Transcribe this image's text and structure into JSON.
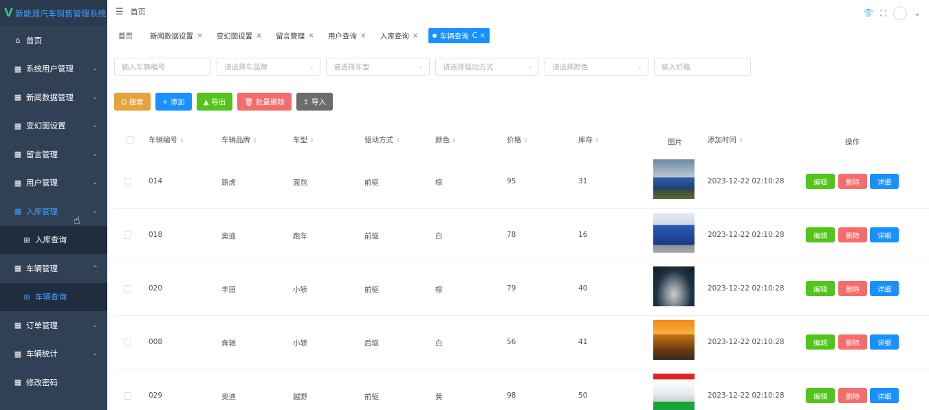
{
  "app": {
    "logo_letter": "V",
    "title": "新能源汽车销售管理系统"
  },
  "topbar": {
    "breadcrumb": "首页"
  },
  "sidebar": {
    "items": [
      {
        "label": "首页",
        "icon": "home-icon",
        "glyph": "⌂",
        "arrow": ""
      },
      {
        "label": "系统用户管理",
        "icon": "grid-icon",
        "glyph": "▦",
        "arrow": "⌄"
      },
      {
        "label": "新闻数据管理",
        "icon": "grid-icon",
        "glyph": "▦",
        "arrow": "⌄"
      },
      {
        "label": "变幻图设置",
        "icon": "grid-icon",
        "glyph": "▦",
        "arrow": "⌄"
      },
      {
        "label": "留言管理",
        "icon": "grid-icon",
        "glyph": "▦",
        "arrow": "⌄"
      },
      {
        "label": "用户管理",
        "icon": "grid-icon",
        "glyph": "▦",
        "arrow": "⌄"
      },
      {
        "label": "入库管理",
        "icon": "grid-icon",
        "glyph": "▦",
        "arrow": "⌄"
      },
      {
        "label": "入库查询",
        "icon": "apps-icon",
        "glyph": "⊞",
        "arrow": ""
      },
      {
        "label": "车辆管理",
        "icon": "grid-icon",
        "glyph": "▦",
        "arrow": "^"
      },
      {
        "label": "车辆查询",
        "icon": "apps-icon",
        "glyph": "⊞",
        "arrow": ""
      },
      {
        "label": "订单管理",
        "icon": "grid-icon",
        "glyph": "▦",
        "arrow": "⌄"
      },
      {
        "label": "车辆统计",
        "icon": "grid-icon",
        "glyph": "▦",
        "arrow": "⌄"
      },
      {
        "label": "修改密码",
        "icon": "grid-icon",
        "glyph": "▦",
        "arrow": ""
      }
    ]
  },
  "tabs": [
    {
      "label": "首页",
      "close": ""
    },
    {
      "label": "新闻数据设置",
      "close": "×"
    },
    {
      "label": "变幻图设置",
      "close": "×"
    },
    {
      "label": "留言管理",
      "close": "×"
    },
    {
      "label": "用户查询",
      "close": "×"
    },
    {
      "label": "入库查询",
      "close": "×"
    },
    {
      "label": "车辆查询",
      "close": "C ×"
    }
  ],
  "filters": [
    {
      "placeholder": "输入车辆编号",
      "dropdown": ""
    },
    {
      "placeholder": "请选择车品牌",
      "dropdown": "⌄"
    },
    {
      "placeholder": "请选择车型",
      "dropdown": "⌄"
    },
    {
      "placeholder": "请选择驱动方式",
      "dropdown": "⌄"
    },
    {
      "placeholder": "请选择颜色",
      "dropdown": "⌄"
    },
    {
      "placeholder": "输入价格",
      "dropdown": ""
    }
  ],
  "buttons": [
    {
      "label": "Q 搜索",
      "color": "#e6a23c"
    },
    {
      "label": "+ 添加",
      "color": "#1890ff"
    },
    {
      "label": "▲ 导出",
      "color": "#52c41a"
    },
    {
      "label": "🗑 批量删除",
      "color": "#f56c6c"
    },
    {
      "label": "⇪ 导入",
      "color": "#6c6c6c"
    }
  ],
  "table": {
    "headers": {
      "id": "车辆编号",
      "brand": "车辆品牌",
      "type": "车型",
      "drive": "驱动方式",
      "color": "颜色",
      "price": "价格",
      "stock": "库存",
      "image": "图片",
      "time": "添加时间",
      "ops": "操作"
    },
    "sort_glyph": "⇕",
    "op_labels": {
      "edit": "编辑",
      "delete": "删除",
      "detail": "详细"
    },
    "rows": [
      {
        "id": "014",
        "brand": "路虎",
        "type": "面包",
        "drive": "前驱",
        "color": "棕",
        "price": "95",
        "stock": "31",
        "time": "2023-12-22 02:10:28"
      },
      {
        "id": "018",
        "brand": "奥迪",
        "type": "跑车",
        "drive": "前驱",
        "color": "白",
        "price": "78",
        "stock": "16",
        "time": "2023-12-22 02:10:28"
      },
      {
        "id": "020",
        "brand": "丰田",
        "type": "小轿",
        "drive": "前驱",
        "color": "棕",
        "price": "79",
        "stock": "40",
        "time": "2023-12-22 02:10:28"
      },
      {
        "id": "008",
        "brand": "奔驰",
        "type": "小轿",
        "drive": "后驱",
        "color": "白",
        "price": "56",
        "stock": "41",
        "time": "2023-12-22 02:10:28"
      },
      {
        "id": "029",
        "brand": "奥迪",
        "type": "越野",
        "drive": "前驱",
        "color": "黄",
        "price": "98",
        "stock": "50",
        "time": "2023-12-22 02:10:28"
      }
    ]
  },
  "colors": {
    "sidebar": "#304156",
    "primary": "#1890ff",
    "edit": "#52c41a",
    "delete": "#f56c6c",
    "detail": "#1890ff"
  }
}
